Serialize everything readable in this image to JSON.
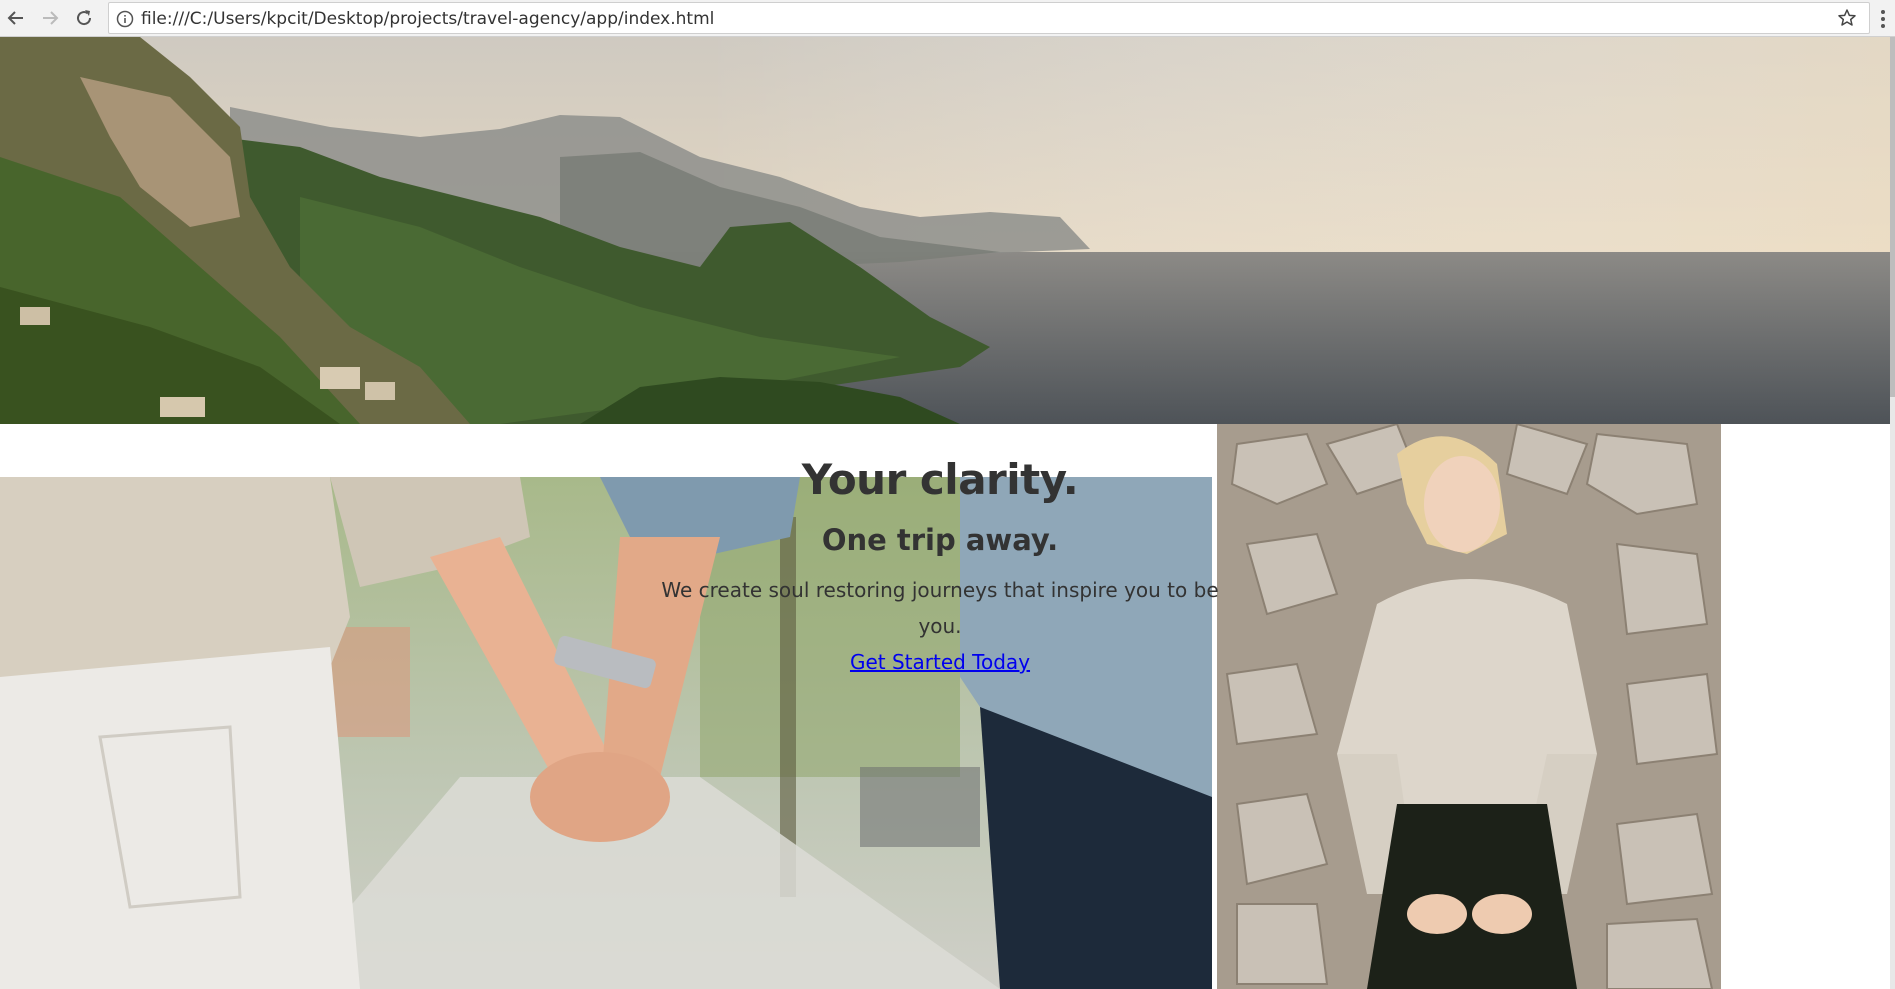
{
  "browser": {
    "url": "file:///C:/Users/kpcit/Desktop/projects/travel-agency/app/index.html",
    "icons": {
      "back": "back-arrow-icon",
      "forward": "forward-arrow-icon",
      "reload": "reload-icon",
      "info": "info-icon",
      "bookmark": "star-icon",
      "menu": "kebab-menu-icon"
    }
  },
  "hero": {
    "title": "Your clarity.",
    "subtitle": "One trip away.",
    "tagline": "We create soul restoring journeys that inspire you to be you.",
    "cta": "Get Started Today"
  },
  "colors": {
    "text": "#333333",
    "link": "#0000ee",
    "background": "#ffffff"
  }
}
